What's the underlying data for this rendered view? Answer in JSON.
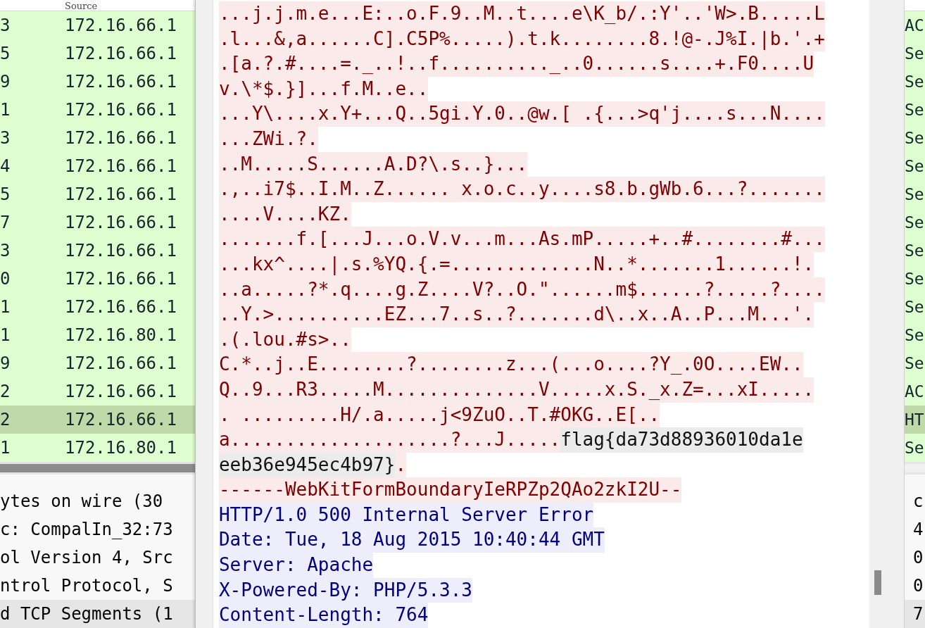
{
  "packet_list": {
    "header": "Source",
    "rows": [
      {
        "no": "3",
        "source": "172.16.66.1",
        "info": "AC",
        "selected": false
      },
      {
        "no": "5",
        "source": "172.16.66.1",
        "info": "Se",
        "selected": false
      },
      {
        "no": "9",
        "source": "172.16.66.1",
        "info": "Se",
        "selected": false
      },
      {
        "no": "1",
        "source": "172.16.66.1",
        "info": "Se",
        "selected": false
      },
      {
        "no": "3",
        "source": "172.16.66.1",
        "info": "Se",
        "selected": false
      },
      {
        "no": "4",
        "source": "172.16.66.1",
        "info": "Se",
        "selected": false
      },
      {
        "no": "5",
        "source": "172.16.66.1",
        "info": "Se",
        "selected": false
      },
      {
        "no": "7",
        "source": "172.16.66.1",
        "info": "Se",
        "selected": false
      },
      {
        "no": "3",
        "source": "172.16.66.1",
        "info": "Se",
        "selected": false
      },
      {
        "no": "0",
        "source": "172.16.66.1",
        "info": "Se",
        "selected": false
      },
      {
        "no": "1",
        "source": "172.16.66.1",
        "info": "Se",
        "selected": false
      },
      {
        "no": "1",
        "source": "172.16.80.1",
        "info": "Se",
        "selected": false
      },
      {
        "no": "9",
        "source": "172.16.66.1",
        "info": "Se",
        "selected": false
      },
      {
        "no": "2",
        "source": "172.16.66.1",
        "info": "AC",
        "selected": false
      },
      {
        "no": "2",
        "source": "172.16.66.1",
        "info": "HT",
        "selected": true
      },
      {
        "no": "1",
        "source": "172.16.80.1",
        "info": "Se",
        "selected": false
      }
    ]
  },
  "packet_details": [
    {
      "text": "ytes on wire (30",
      "bytes": "c",
      "selected": false
    },
    {
      "text": "c: CompalIn_32:73",
      "bytes": "4",
      "selected": false
    },
    {
      "text": "ol Version 4, Src",
      "bytes": "0",
      "selected": false
    },
    {
      "text": "ntrol Protocol, S",
      "bytes": "0",
      "selected": false
    },
    {
      "text": "d TCP Segments (1",
      "bytes": "7",
      "selected": true
    }
  ],
  "stream": [
    {
      "kind": "client",
      "text": "...j.j.m.e...E:..o.F.9..M..t....e\\K_b/.:Y'..'W>.B.....L"
    },
    {
      "kind": "client",
      "text": ".l...&,a......C].C5P%.....).t.k........8.!@-.J%I.|b.'.+"
    },
    {
      "kind": "client",
      "text": ".[a.?.#....=._..!..f.........._..0......s....+.F0....U"
    },
    {
      "kind": "client",
      "text": "v.\\*$.}]...f.M..e.."
    },
    {
      "kind": "client",
      "text": "...Y\\....x.Y+...Q..5gi.Y.0..@w.[ .{...>q'j....s...N...."
    },
    {
      "kind": "client",
      "text": "...ZWi.?."
    },
    {
      "kind": "client",
      "text": "..M.....S......A.D?\\.s..}..."
    },
    {
      "kind": "client",
      "text": ".,..i7$..I.M..Z...... x.o.c..y....s8.b.gWb.6...?......."
    },
    {
      "kind": "client",
      "text": "....V....KZ."
    },
    {
      "kind": "client",
      "text": ".......f.[...J...o.V.v...m...As.mP.....+..#........#..."
    },
    {
      "kind": "client",
      "text": "...kx^....|.s.%YQ.{.=.............N..*.......1......!."
    },
    {
      "kind": "client",
      "text": "..a.....?*.q....g.Z....V?..O.\"......m$......?.....?...."
    },
    {
      "kind": "client",
      "text": "..Y.>..........EZ...7..s..?.......d\\..x..A..P...M...'."
    },
    {
      "kind": "client",
      "text": ".(.lou.#s>.."
    },
    {
      "kind": "client",
      "text": "C.*..j..E........?........z...(...o....?Y_.0O....EW.."
    },
    {
      "kind": "client",
      "text": "Q..9...R3.....M..............V.....x.S._x.Z=...xI....."
    },
    {
      "kind": "client",
      "text": ". .........H/.a.....j<9ZuO..T.#OKG..E[.."
    },
    {
      "kind": "client",
      "parts": [
        {
          "text": "a....................?...J.....",
          "selected": false
        },
        {
          "text": "flag{da73d88936010da1e",
          "selected": true
        }
      ]
    },
    {
      "kind": "client",
      "parts": [
        {
          "text": "eeb36e945ec4b97}",
          "selected": true
        },
        {
          "text": ".",
          "selected": false
        }
      ]
    },
    {
      "kind": "client",
      "text": "------WebKitFormBoundaryIeRPZp2QAo2zkI2U--"
    },
    {
      "kind": "server",
      "text": "HTTP/1.0 500 Internal Server Error"
    },
    {
      "kind": "server",
      "text": "Date: Tue, 18 Aug 2015 10:40:44 GMT"
    },
    {
      "kind": "server",
      "text": "Server: Apache"
    },
    {
      "kind": "server",
      "text": "X-Powered-By: PHP/5.3.3"
    },
    {
      "kind": "server",
      "text": "Content-Length: 764"
    }
  ]
}
